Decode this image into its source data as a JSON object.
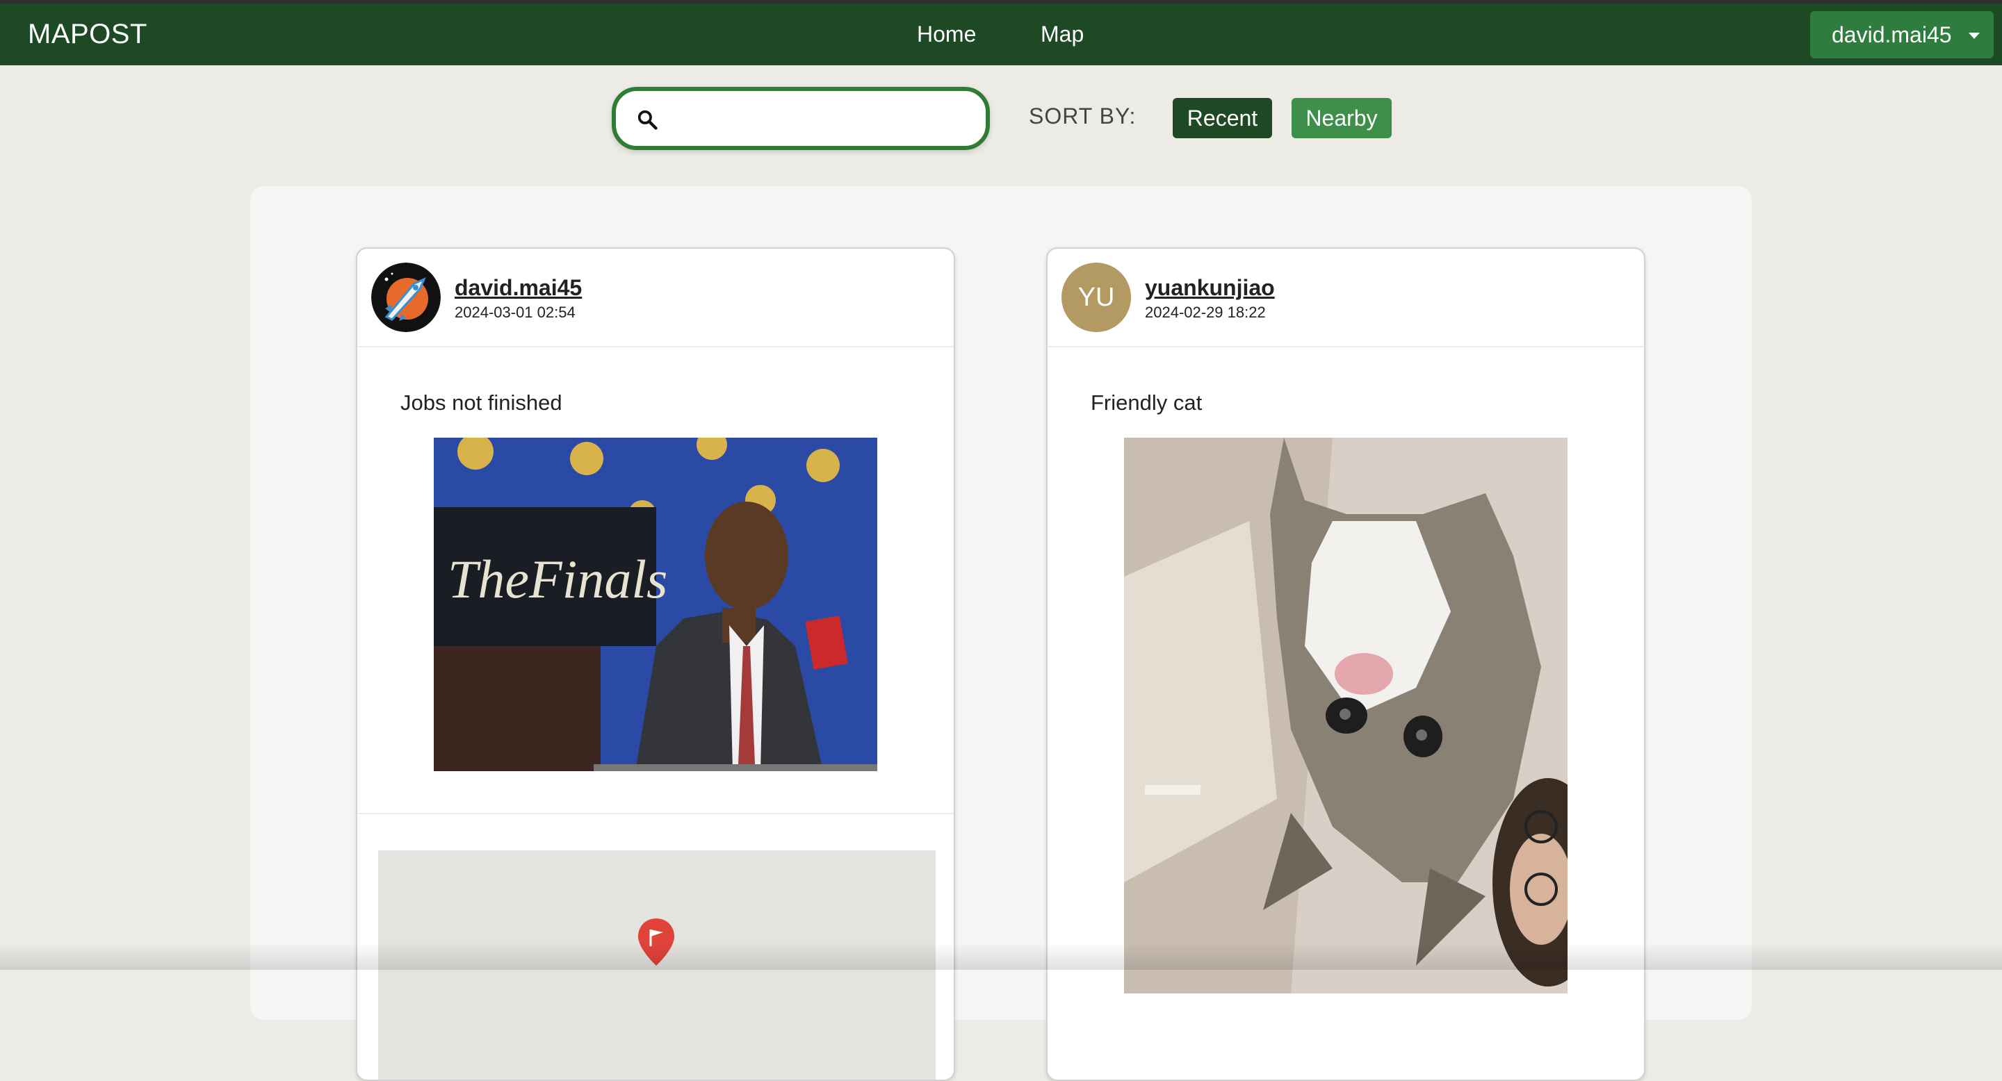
{
  "navbar": {
    "brand": "MAPOST",
    "links": [
      "Home",
      "Map"
    ],
    "user": "david.mai45"
  },
  "toolbar": {
    "search_placeholder": "",
    "sort_label": "SORT BY:",
    "sort_options": [
      "Recent",
      "Nearby"
    ],
    "active_sort": "Recent"
  },
  "posts": [
    {
      "username": "david.mai45",
      "timestamp": "2024-03-01 02:54",
      "caption": "Jobs not finished",
      "avatar": "rocket-logo",
      "has_map": true
    },
    {
      "username": "yuankunjiao",
      "timestamp": "2024-02-29 18:22",
      "caption": "Friendly cat",
      "avatar_initials": "YU"
    }
  ],
  "colors": {
    "navbar": "#1d4a24",
    "accent": "#2e7d32",
    "nearby": "#3d8f4a",
    "avatar_initials_bg": "#b39a63"
  }
}
